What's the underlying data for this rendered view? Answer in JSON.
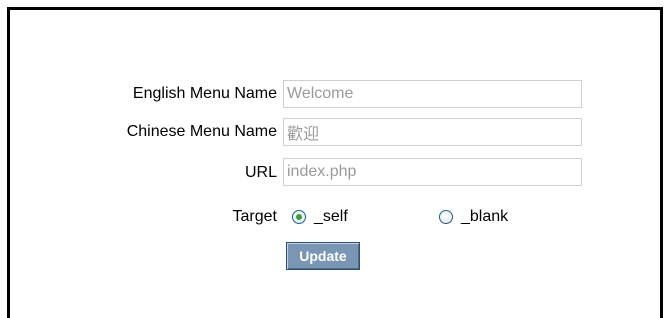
{
  "form": {
    "english_menu_name": {
      "label": "English Menu Name",
      "value": "Welcome"
    },
    "chinese_menu_name": {
      "label": "Chinese Menu Name",
      "value": "歡迎"
    },
    "url": {
      "label": "URL",
      "value": "index.php"
    },
    "target": {
      "label": "Target",
      "options": [
        {
          "label": "_self",
          "selected": true
        },
        {
          "label": "_blank",
          "selected": false
        }
      ]
    },
    "update_label": "Update"
  },
  "colors": {
    "frame_border": "#000000",
    "field_border": "#cfcfcf",
    "field_text": "#9a9a9a",
    "button_bg": "#7996b5",
    "button_border": "#2e4f72",
    "radio_selected": "#2fa52f"
  }
}
